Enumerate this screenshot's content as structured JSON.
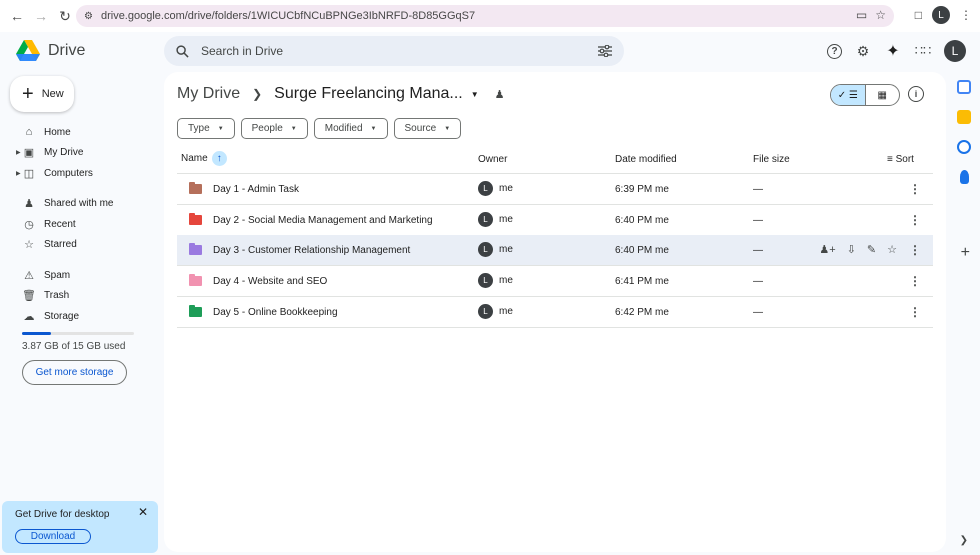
{
  "browser": {
    "url": "drive.google.com/drive/folders/1WICUCbfNCuBPNGe3IbNRFD-8D85GGqS7",
    "profile_initial": "L"
  },
  "app": {
    "name": "Drive",
    "search_placeholder": "Search in Drive",
    "profile_initial": "L"
  },
  "sidebar": {
    "new_label": "New",
    "items": [
      {
        "label": "Home",
        "icon": "home-icon"
      },
      {
        "label": "My Drive",
        "icon": "my-drive-icon"
      },
      {
        "label": "Computers",
        "icon": "computer-icon"
      },
      {
        "label": "Shared with me",
        "icon": "people-icon"
      },
      {
        "label": "Recent",
        "icon": "clock-icon"
      },
      {
        "label": "Starred",
        "icon": "star-icon"
      },
      {
        "label": "Spam",
        "icon": "spam-icon"
      },
      {
        "label": "Trash",
        "icon": "trash-icon"
      },
      {
        "label": "Storage",
        "icon": "cloud-icon"
      }
    ],
    "storage_used_fraction": 0.258,
    "storage_text": "3.87 GB of 15 GB used",
    "get_more_label": "Get more storage"
  },
  "desktop_promo": {
    "title": "Get Drive for desktop",
    "download_label": "Download"
  },
  "breadcrumb": {
    "root": "My Drive",
    "current": "Surge Freelancing Mana..."
  },
  "filters": [
    "Type",
    "People",
    "Modified",
    "Source"
  ],
  "table": {
    "headers": {
      "name": "Name",
      "owner": "Owner",
      "modified": "Date modified",
      "size": "File size",
      "sort": "Sort"
    },
    "rows": [
      {
        "name": "Day 1 - Admin Task",
        "owner": "me",
        "owner_initial": "L",
        "modified": "6:39 PM me",
        "size": "—",
        "color": "#b56f5b"
      },
      {
        "name": "Day 2 - Social Media Management and Marketing",
        "owner": "me",
        "owner_initial": "L",
        "modified": "6:40 PM me",
        "size": "—",
        "color": "#e5463c"
      },
      {
        "name": "Day 3 - Customer Relationship Management",
        "owner": "me",
        "owner_initial": "L",
        "modified": "6:40 PM me",
        "size": "—",
        "color": "#9a7ae0"
      },
      {
        "name": "Day 4 - Website and SEO",
        "owner": "me",
        "owner_initial": "L",
        "modified": "6:41 PM me",
        "size": "—",
        "color": "#f192b0"
      },
      {
        "name": "Day 5 - Online Bookkeeping",
        "owner": "me",
        "owner_initial": "L",
        "modified": "6:42 PM me",
        "size": "—",
        "color": "#1e9d58"
      }
    ]
  },
  "colors": {
    "accent": "#0b57d0",
    "chip_blue": "#c2e7ff",
    "search_bg": "#e9eef6"
  }
}
